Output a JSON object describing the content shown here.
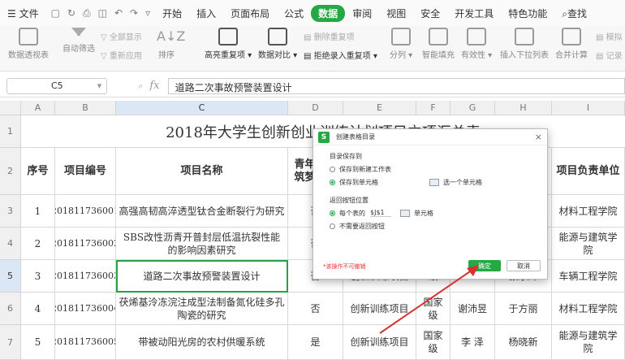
{
  "menu": {
    "file": "文件",
    "tabs": [
      "开始",
      "插入",
      "页面布局",
      "公式",
      "数据",
      "审阅",
      "视图",
      "安全",
      "开发工具",
      "特色功能"
    ],
    "active": "数据",
    "search": "查找"
  },
  "ribbon": {
    "pivot": "数据透视表",
    "autofilter": "自动筛选",
    "show_all": "全部显示",
    "reapply": "重新应用",
    "sort": "排序",
    "highlight_dup": "高亮重复项",
    "compare": "数据对比",
    "delete_dup": "删除重复项",
    "reject_dup": "拒绝录入重复项",
    "split": "分列",
    "smart_fill": "智能填充",
    "validity": "有效性",
    "insert_dropdown": "插入下拉列表",
    "consolidate": "合并计算",
    "simulate": "模拟",
    "record": "记录"
  },
  "formula_bar": {
    "cell_ref": "C5",
    "fx": "fx",
    "content": "道路二次事故预警装置设计"
  },
  "columns": [
    "A",
    "B",
    "C",
    "D",
    "E",
    "F",
    "G",
    "H",
    "I"
  ],
  "rows": [
    "1",
    "2",
    "3",
    "4",
    "5",
    "6",
    "7"
  ],
  "sheet": {
    "title": "2018年大学生创新创业训练计划项目立项汇总表",
    "headers": {
      "a": "序号",
      "b": "项目编号",
      "c": "项目名称",
      "d": "青年红色筑梦之旅",
      "e": "",
      "f": "",
      "g": "",
      "h": "",
      "i": "项目负责单位"
    },
    "data": [
      {
        "a": "1",
        "b": "201811736001",
        "c": "高强高韧高淬透型钛合金断裂行为研究",
        "d": "否",
        "e": "",
        "f": "",
        "g": "",
        "h": "",
        "i": "材料工程学院"
      },
      {
        "a": "2",
        "b": "201811736002",
        "c": "SBS改性沥青开普封层低温抗裂性能的影响因素研究",
        "d": "否",
        "e": "",
        "f": "",
        "g": "",
        "h": "",
        "i": "能源与建筑学院"
      },
      {
        "a": "3",
        "b": "201811736003",
        "c": "道路二次事故预警装置设计",
        "d": "否",
        "e": "创新训练项目",
        "f": "级",
        "g": "",
        "h": "张乐辉",
        "i": "车辆工程学院"
      },
      {
        "a": "4",
        "b": "201811736004",
        "c": "茯烯基泠冻浣注成型法制备氮化硅多孔陶瓷的研究",
        "d": "否",
        "e": "创新训练项目",
        "f": "国家级",
        "g": "谢沛昱",
        "h": "于方丽",
        "i": "材料工程学院"
      },
      {
        "a": "5",
        "b": "201811736005",
        "c": "带被动阳光房的农村供暖系统",
        "d": "是",
        "e": "创新训练项目",
        "f": "国家级",
        "g": "李 泽",
        "h": "杨晓新",
        "i": "能源与建筑学院"
      }
    ]
  },
  "dialog": {
    "title": "创建表格目录",
    "section1": "目录保存到",
    "opt_new_sheet": "保存到新建工作表",
    "opt_cell": "保存到单元格",
    "select_cell": "选一个单元格",
    "section2": "返回按钮位置",
    "opt_each": "每个表的",
    "each_value": "$J$1",
    "cell_label": "单元格",
    "opt_none": "不需要返回按钮",
    "warning": "*该操作不可撤销",
    "ok": "确定",
    "cancel": "取消"
  },
  "colors": {
    "accent": "#26a845",
    "arrow": "#d93030",
    "selection": "#27a046"
  }
}
